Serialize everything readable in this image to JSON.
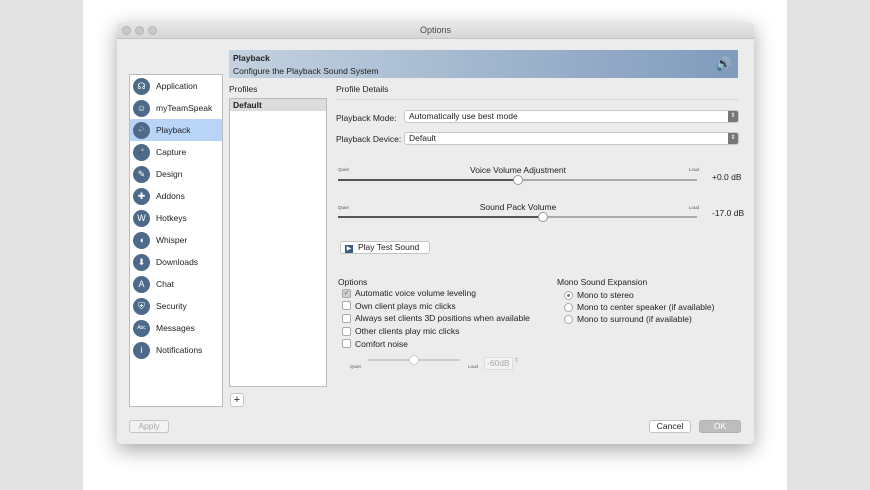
{
  "window": {
    "title": "Options"
  },
  "sidebar": {
    "items": [
      {
        "label": "Application",
        "icon": "headset-icon",
        "glyph": "☊"
      },
      {
        "label": "myTeamSpeak",
        "icon": "user-icon",
        "glyph": "☺"
      },
      {
        "label": "Playback",
        "icon": "speaker-icon",
        "glyph": "🔊"
      },
      {
        "label": "Capture",
        "icon": "microphone-icon",
        "glyph": "🎤"
      },
      {
        "label": "Design",
        "icon": "pen-icon",
        "glyph": "✎"
      },
      {
        "label": "Addons",
        "icon": "puzzle-icon",
        "glyph": "✚"
      },
      {
        "label": "Hotkeys",
        "icon": "keyboard-icon",
        "glyph": "W"
      },
      {
        "label": "Whisper",
        "icon": "whisper-icon",
        "glyph": "◖"
      },
      {
        "label": "Downloads",
        "icon": "download-icon",
        "glyph": "⬇"
      },
      {
        "label": "Chat",
        "icon": "chat-icon",
        "glyph": "A"
      },
      {
        "label": "Security",
        "icon": "shield-icon",
        "glyph": "⛨"
      },
      {
        "label": "Messages",
        "icon": "messages-icon",
        "glyph": "Abc"
      },
      {
        "label": "Notifications",
        "icon": "info-icon",
        "glyph": "i"
      }
    ],
    "selected": "Playback"
  },
  "header": {
    "title": "Playback",
    "subtitle": "Configure the Playback Sound System"
  },
  "profiles": {
    "label": "Profiles",
    "items": [
      "Default"
    ],
    "add_label": "+"
  },
  "details": {
    "label": "Profile Details",
    "playback_mode": {
      "label": "Playback Mode:",
      "value": "Automatically use best mode"
    },
    "playback_device": {
      "label": "Playback Device:",
      "value": "Default"
    },
    "voice_volume": {
      "label": "Voice Volume Adjustment",
      "min_label": "Quiet",
      "max_label": "Loud",
      "value_text": "+0.0 dB",
      "fraction": 0.5
    },
    "sound_pack": {
      "label": "Sound Pack Volume",
      "min_label": "Quiet",
      "max_label": "Loud",
      "value_text": "-17.0 dB",
      "fraction": 0.57
    },
    "play_test": "Play Test Sound"
  },
  "options": {
    "label": "Options",
    "items": [
      {
        "label": "Automatic voice volume leveling",
        "checked": true
      },
      {
        "label": "Own client plays mic clicks",
        "checked": false
      },
      {
        "label": "Always set clients 3D positions when available",
        "checked": false
      },
      {
        "label": "Other clients play mic clicks",
        "checked": false
      },
      {
        "label": "Comfort noise",
        "checked": false
      }
    ],
    "comfort": {
      "min_label": "Quiet",
      "max_label": "Loud",
      "value": "-60dB",
      "fraction": 0.5
    }
  },
  "mono": {
    "label": "Mono Sound Expansion",
    "items": [
      {
        "label": "Mono to stereo",
        "selected": true
      },
      {
        "label": "Mono to center speaker (if available)",
        "selected": false
      },
      {
        "label": "Mono to surround (if available)",
        "selected": false
      }
    ]
  },
  "footer": {
    "apply": "Apply",
    "cancel": "Cancel",
    "ok": "OK"
  }
}
